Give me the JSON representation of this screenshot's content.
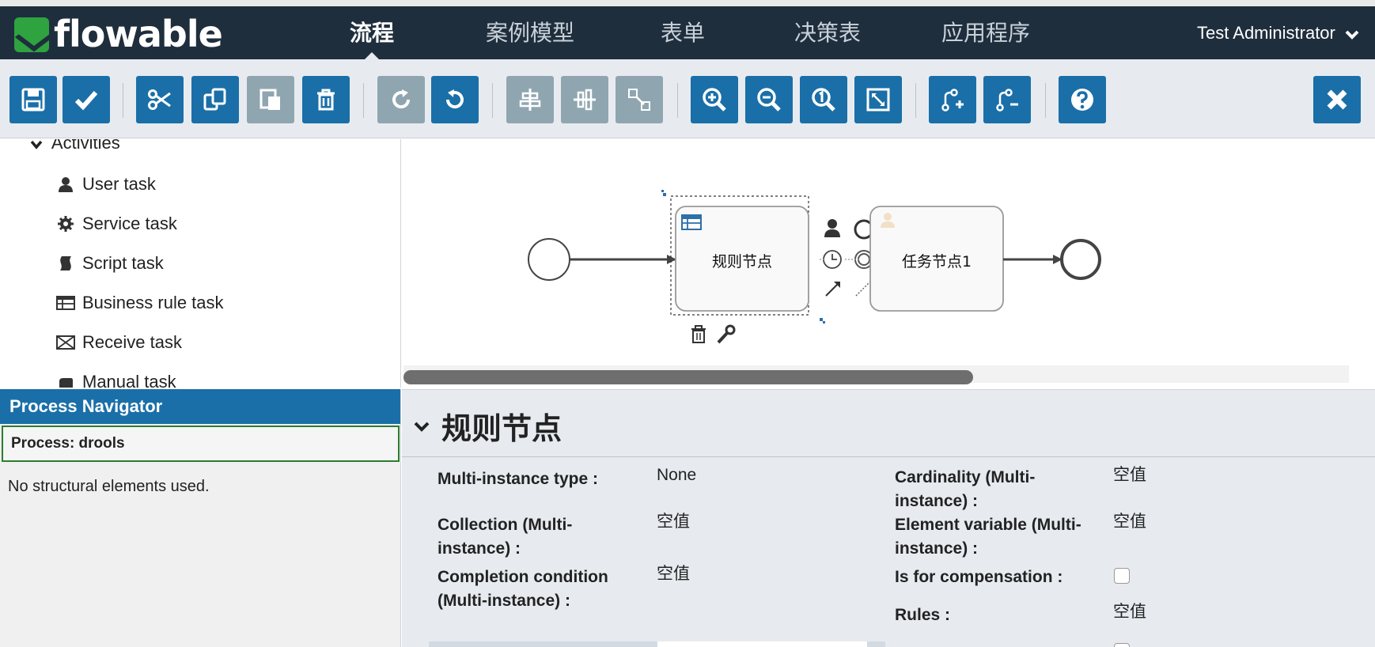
{
  "header": {
    "brand": "flowable",
    "nav": [
      "流程",
      "案例模型",
      "表单",
      "决策表",
      "应用程序"
    ],
    "active_nav": "流程",
    "user": "Test Administrator"
  },
  "toolbar": {
    "buttons": [
      "save",
      "validate",
      "cut",
      "copy",
      "paste",
      "delete",
      "redo",
      "undo",
      "align-horizontal",
      "align-vertical",
      "same-size",
      "zoom-in",
      "zoom-out",
      "zoom-actual",
      "zoom-fit",
      "add-bendpoint",
      "remove-bendpoint",
      "help",
      "close"
    ]
  },
  "palette": {
    "group": "Activities",
    "items": [
      {
        "label": "User task",
        "icon": "user-icon"
      },
      {
        "label": "Service task",
        "icon": "gear-icon"
      },
      {
        "label": "Script task",
        "icon": "script-icon"
      },
      {
        "label": "Business rule task",
        "icon": "table-icon"
      },
      {
        "label": "Receive task",
        "icon": "envelope-icon"
      },
      {
        "label": "Manual task",
        "icon": "hand-icon"
      }
    ]
  },
  "navigator": {
    "title": "Process Navigator",
    "process": "Process: drools",
    "empty": "No structural elements used."
  },
  "diagram": {
    "task1": "规则节点",
    "task2": "任务节点1"
  },
  "properties": {
    "title": "规则节点",
    "fields": [
      {
        "label": "Multi-instance type :",
        "value": "None"
      },
      {
        "label": "Cardinality (Multi-instance) :",
        "value": "空值"
      },
      {
        "label": "Collection (Multi-instance) :",
        "value": "空值"
      },
      {
        "label": "Element variable (Multi-instance) :",
        "value": "空值"
      },
      {
        "label": "Completion condition (Multi-instance) :",
        "value": "空值"
      },
      {
        "label": "Is for compensation :",
        "value": ""
      },
      {
        "label": "Rules :",
        "value": "空值"
      }
    ]
  }
}
